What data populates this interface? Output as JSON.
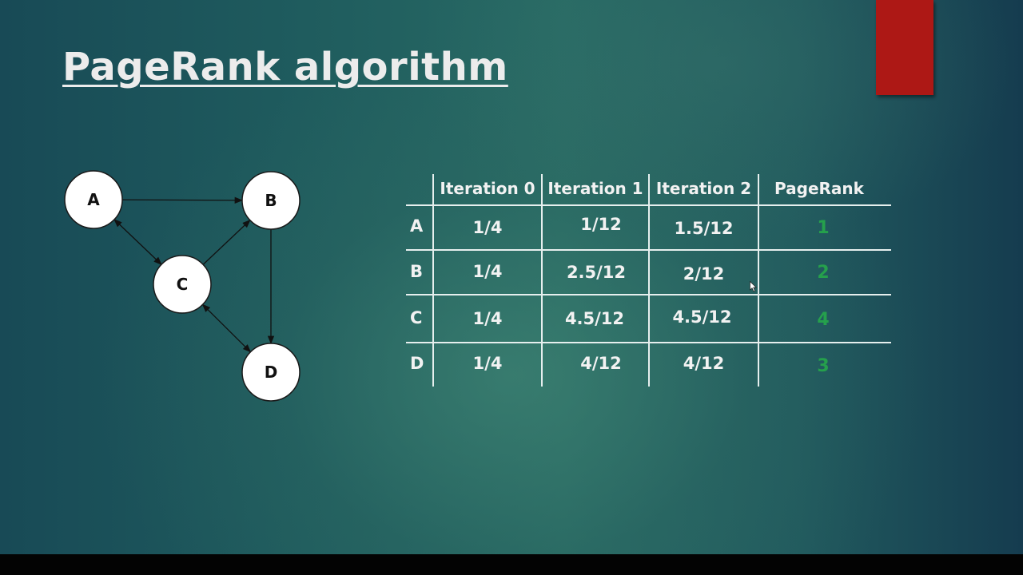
{
  "slide": {
    "title": "PageRank algorithm",
    "accent_color": "#ad1815",
    "rank_color": "#25a04c"
  },
  "graph": {
    "nodes": [
      {
        "id": "A",
        "label": "A"
      },
      {
        "id": "B",
        "label": "B"
      },
      {
        "id": "C",
        "label": "C"
      },
      {
        "id": "D",
        "label": "D"
      }
    ],
    "edges": [
      {
        "from": "A",
        "to": "B",
        "bidirectional": false
      },
      {
        "from": "A",
        "to": "C",
        "bidirectional": true
      },
      {
        "from": "C",
        "to": "B",
        "bidirectional": false
      },
      {
        "from": "B",
        "to": "D",
        "bidirectional": false
      },
      {
        "from": "C",
        "to": "D",
        "bidirectional": true
      }
    ]
  },
  "table": {
    "headers": [
      "",
      "Iteration 0",
      "Iteration 1",
      "Iteration 2",
      "PageRank"
    ],
    "rows": [
      {
        "node": "A",
        "iter0": "1/4",
        "iter1": "1/12",
        "iter2": "1.5/12",
        "rank": "1"
      },
      {
        "node": "B",
        "iter0": "1/4",
        "iter1": "2.5/12",
        "iter2": "2/12",
        "rank": "2"
      },
      {
        "node": "C",
        "iter0": "1/4",
        "iter1": "4.5/12",
        "iter2": "4.5/12",
        "rank": "4"
      },
      {
        "node": "D",
        "iter0": "1/4",
        "iter1": "4/12",
        "iter2": "4/12",
        "rank": "3"
      }
    ]
  }
}
